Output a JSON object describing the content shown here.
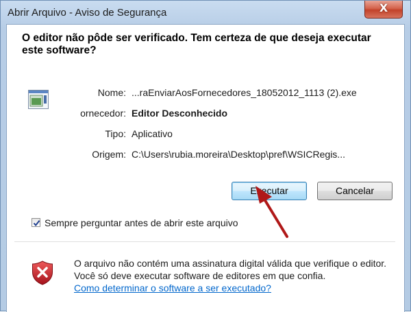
{
  "window": {
    "title": "Abrir Arquivo - Aviso de Segurança",
    "close_label": "X"
  },
  "dialog": {
    "question": "O editor não pôde ser verificado. Tem certeza de que deseja executar este software?",
    "fields": [
      {
        "label": "Nome:",
        "value": "...raEnviarAosFornecedores_18052012_1113 (2).exe"
      },
      {
        "label": "ornecedor:",
        "value": "Editor Desconhecido"
      },
      {
        "label": "Tipo:",
        "value": "Aplicativo"
      },
      {
        "label": "Origem:",
        "value": "C:\\Users\\rubia.moreira\\Desktop\\pref\\WSICRegis..."
      }
    ],
    "buttons": {
      "execute_label": "Executar",
      "cancel_label": "Cancelar"
    },
    "checkbox": {
      "label": "Sempre perguntar antes de abrir este arquivo",
      "checked": true
    },
    "warning": {
      "text": "O arquivo não contém uma assinatura digital válida que verifique o editor. Você só deve executar software de editores em que confia.",
      "link": "Como determinar o software a ser executado?"
    }
  },
  "icons": {
    "app": "application-icon",
    "shield": "security-shield-icon",
    "arrow": "red-arrow-annotation"
  },
  "colors": {
    "link": "#0066cc",
    "shield": "#c0202a",
    "arrow": "#b01818"
  }
}
